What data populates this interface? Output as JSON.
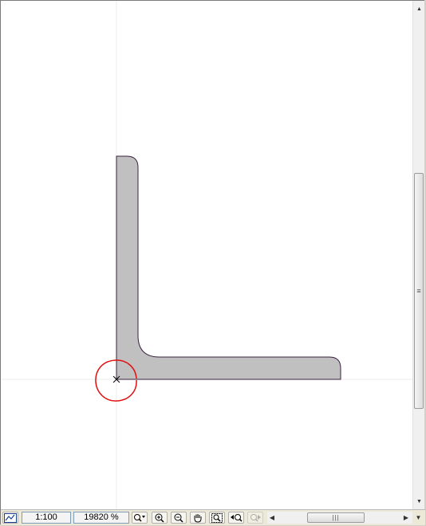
{
  "toolbar": {
    "scale_value": "1:100",
    "zoom_value": "19820 %"
  },
  "icons": {
    "view_toggle": "view-mode-icon",
    "zoom_dropdown": "zoom-dropdown-icon",
    "zoom_in": "zoom-in-icon",
    "zoom_out": "zoom-out-icon",
    "pan": "pan-hand-icon",
    "fit": "zoom-to-fit-icon",
    "prev_zoom": "previous-zoom-icon",
    "next_zoom": "next-zoom-icon"
  },
  "colors": {
    "profile_fill": "#c0c0c0",
    "profile_outline": "#3a1f3f",
    "marker_circle": "#e01010"
  }
}
